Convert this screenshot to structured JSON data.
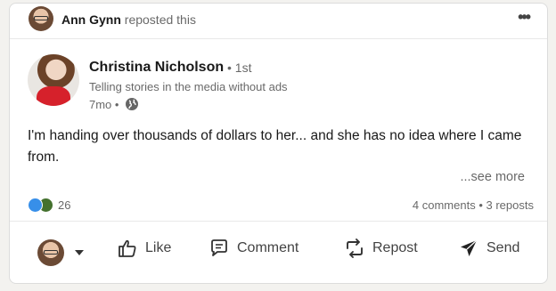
{
  "repost_header": {
    "reposter_name": "Ann Gynn",
    "action_text": "reposted this"
  },
  "post": {
    "author_name": "Christina Nicholson",
    "degree": "• 1st",
    "headline": "Telling stories in the media without ads",
    "age": "7mo •",
    "text": "I'm handing over thousands of dollars to her... and she has no idea where I came from.",
    "see_more": "...see more"
  },
  "social": {
    "reaction_count": "26",
    "comments": "4 comments",
    "separator": "•",
    "reposts": "3 reposts"
  },
  "actions": {
    "like": "Like",
    "comment": "Comment",
    "repost": "Repost",
    "send": "Send"
  },
  "icons": {
    "more": "more-horizontal-icon",
    "globe": "globe-icon",
    "like": "thumbs-up-icon",
    "comment": "comment-icon",
    "repost": "repost-icon",
    "send": "send-icon"
  },
  "colors": {
    "like_reaction": "#378fe9",
    "celebrate_reaction": "#44712e"
  }
}
